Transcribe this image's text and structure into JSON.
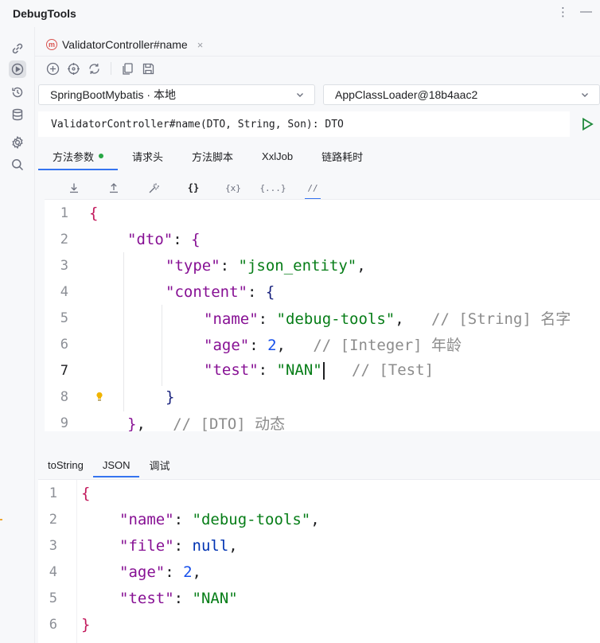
{
  "app": {
    "title": "DebugTools"
  },
  "sidebar_icons": [
    "link-icon",
    "run-icon",
    "history-icon",
    "database-icon",
    "settings-icon",
    "search-icon"
  ],
  "file_tab": {
    "label": "ValidatorController#name",
    "icon_letter": "m"
  },
  "toolbar_icons": [
    "add-icon",
    "target-icon",
    "refresh-icon",
    "copy-icon",
    "save-icon"
  ],
  "project_select": {
    "value": "SpringBootMybatis · 本地"
  },
  "classloader_select": {
    "value": "AppClassLoader@18b4aac2"
  },
  "method_signature": "ValidatorController#name(DTO, String, Son): DTO",
  "main_tabs": [
    {
      "label": "方法参数"
    },
    {
      "label": "请求头"
    },
    {
      "label": "方法脚本"
    },
    {
      "label": "XxlJob"
    },
    {
      "label": "链路耗时"
    }
  ],
  "editor_toolbar": [
    "↓",
    "↑",
    "✱",
    "{}",
    "{x}",
    "{...}",
    "//"
  ],
  "editor": {
    "line_numbers": [
      "1",
      "2",
      "3",
      "4",
      "5",
      "6",
      "7",
      "8",
      "9"
    ],
    "current_line": "7",
    "lines": [
      [
        "{"
      ],
      [
        "\"dto\"",
        ": ",
        "{"
      ],
      [
        "\"type\"",
        ": ",
        "\"json_entity\"",
        ","
      ],
      [
        "\"content\"",
        ": ",
        "{"
      ],
      [
        "\"name\"",
        ": ",
        "\"debug-tools\"",
        ",",
        "   // [String] 名字"
      ],
      [
        "\"age\"",
        ": ",
        "2",
        ",",
        "   // [Integer] 年龄"
      ],
      [
        "\"test\"",
        ": ",
        "\"NAN\"",
        "   // [Test]"
      ],
      [
        "}"
      ],
      [
        "}",
        ",",
        "   // [DTO] 动态"
      ]
    ]
  },
  "result_tabs": [
    {
      "label": "toString"
    },
    {
      "label": "JSON"
    },
    {
      "label": "调试"
    }
  ],
  "result": {
    "line_numbers": [
      "1",
      "2",
      "3",
      "4",
      "5",
      "6"
    ],
    "lines": [
      [
        "{"
      ],
      [
        "\"name\"",
        ": ",
        "\"debug-tools\"",
        ","
      ],
      [
        "\"file\"",
        ": ",
        "null",
        ","
      ],
      [
        "\"age\"",
        ": ",
        "2",
        ","
      ],
      [
        "\"test\"",
        ": ",
        "\"NAN\""
      ],
      [
        "}"
      ]
    ]
  }
}
